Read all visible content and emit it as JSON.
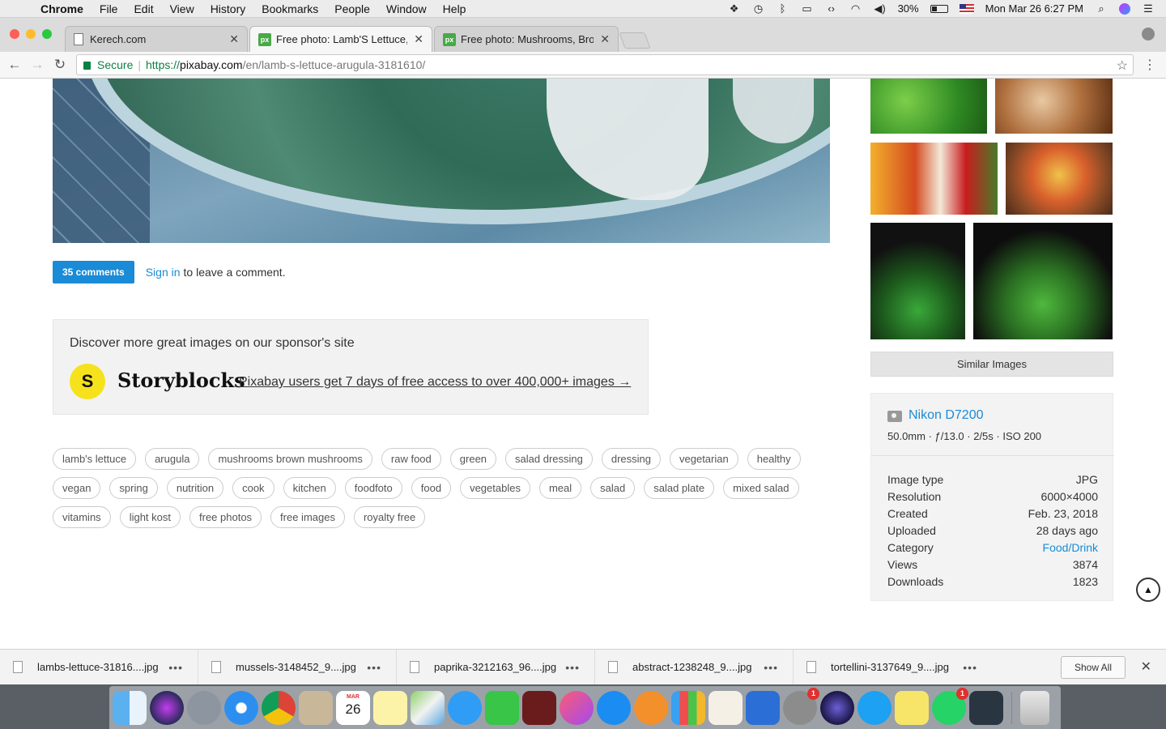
{
  "menubar": {
    "app": "Chrome",
    "items": [
      "File",
      "Edit",
      "View",
      "History",
      "Bookmarks",
      "People",
      "Window",
      "Help"
    ],
    "battery": "30%",
    "datetime": "Mon Mar 26  6:27 PM"
  },
  "tabs": [
    {
      "title": "Kerech.com",
      "favicon": "doc"
    },
    {
      "title": "Free photo: Lamb'S Lettuce, A",
      "favicon": "px"
    },
    {
      "title": "Free photo: Mushrooms, Brow",
      "favicon": "px"
    }
  ],
  "favicon_text": "px",
  "address": {
    "secure_label": "Secure",
    "url_scheme": "https://",
    "url_host": "pixabay.com",
    "url_path": "/en/lamb-s-lettuce-arugula-3181610/"
  },
  "comments": {
    "count_label": "35 comments",
    "signin": "Sign in",
    "rest": "to leave a comment."
  },
  "sponsor": {
    "heading": "Discover more great images on our sponsor's site",
    "logo_letter": "S",
    "brand": "Storyblocks",
    "link": "Pixabay users get 7 days of free access to over 400,000+ images →"
  },
  "tags": [
    "lamb's lettuce",
    "arugula",
    "mushrooms brown mushrooms",
    "raw food",
    "green",
    "salad dressing",
    "dressing",
    "vegetarian",
    "healthy",
    "vegan",
    "spring",
    "nutrition",
    "cook",
    "kitchen",
    "foodfoto",
    "food",
    "vegetables",
    "meal",
    "salad",
    "salad plate",
    "mixed salad",
    "vitamins",
    "light kost",
    "free photos",
    "free images",
    "royalty free"
  ],
  "sidebar": {
    "similar_button": "Similar Images",
    "camera": "Nikon D7200",
    "exif": "50.0mm · ƒ/13.0 · 2/5s · ISO 200",
    "info": [
      {
        "label": "Image type",
        "value": "JPG"
      },
      {
        "label": "Resolution",
        "value": "6000×4000"
      },
      {
        "label": "Created",
        "value": "Feb. 23, 2018"
      },
      {
        "label": "Uploaded",
        "value": "28 days ago"
      },
      {
        "label": "Category",
        "value": "Food/Drink"
      },
      {
        "label": "Views",
        "value": "3874"
      },
      {
        "label": "Downloads",
        "value": "1823"
      }
    ]
  },
  "downloads": {
    "items": [
      "lambs-lettuce-31816....jpg",
      "mussels-3148452_9....jpg",
      "paprika-3212163_96....jpg",
      "abstract-1238248_9....jpg",
      "tortellini-3137649_9....jpg"
    ],
    "more": "•••",
    "show_all": "Show All"
  },
  "dock": {
    "calendar_month": "MAR",
    "calendar_day": "26",
    "badges": {
      "system_preferences": "1",
      "whatsapp": "1"
    }
  },
  "colors": {
    "accent": "#1a8bd6",
    "secure_green": "#0b8043",
    "storyblocks_yellow": "#f5e21c"
  }
}
